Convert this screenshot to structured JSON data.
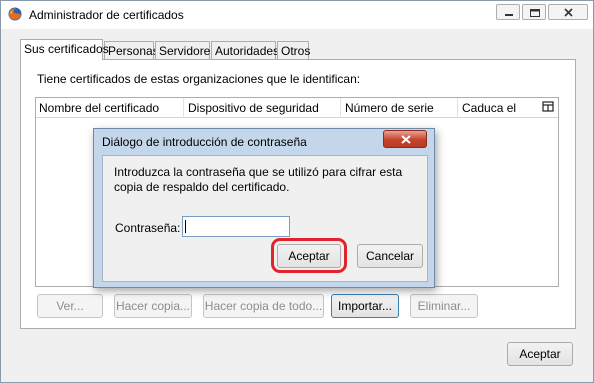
{
  "window": {
    "title": "Administrador de certificados",
    "app_icon": "firefox-icon"
  },
  "tabs": [
    {
      "label": "Sus certificados",
      "active": true
    },
    {
      "label": "Personas",
      "active": false
    },
    {
      "label": "Servidores",
      "active": false
    },
    {
      "label": "Autoridades",
      "active": false
    },
    {
      "label": "Otros",
      "active": false
    }
  ],
  "panel": {
    "intro": "Tiene certificados de estas organizaciones que le identifican:",
    "columns": [
      "Nombre del certificado",
      "Dispositivo de seguridad",
      "Número de serie",
      "Caduca el"
    ],
    "column_picker_icon": "column-picker-icon",
    "buttons": [
      "Ver...",
      "Hacer copia...",
      "Hacer copia de todo...",
      "Importar...",
      "Eliminar..."
    ]
  },
  "footer": {
    "ok_label": "Aceptar"
  },
  "dialog": {
    "title": "Diálogo de introducción de contraseña",
    "message": "Introduzca la contraseña que se utilizó para cifrar esta copia de respaldo del certificado.",
    "password_label": "Contraseña:",
    "password_value": "",
    "ok_label": "Aceptar",
    "cancel_label": "Cancelar",
    "highlight_color": "#e2232c"
  }
}
